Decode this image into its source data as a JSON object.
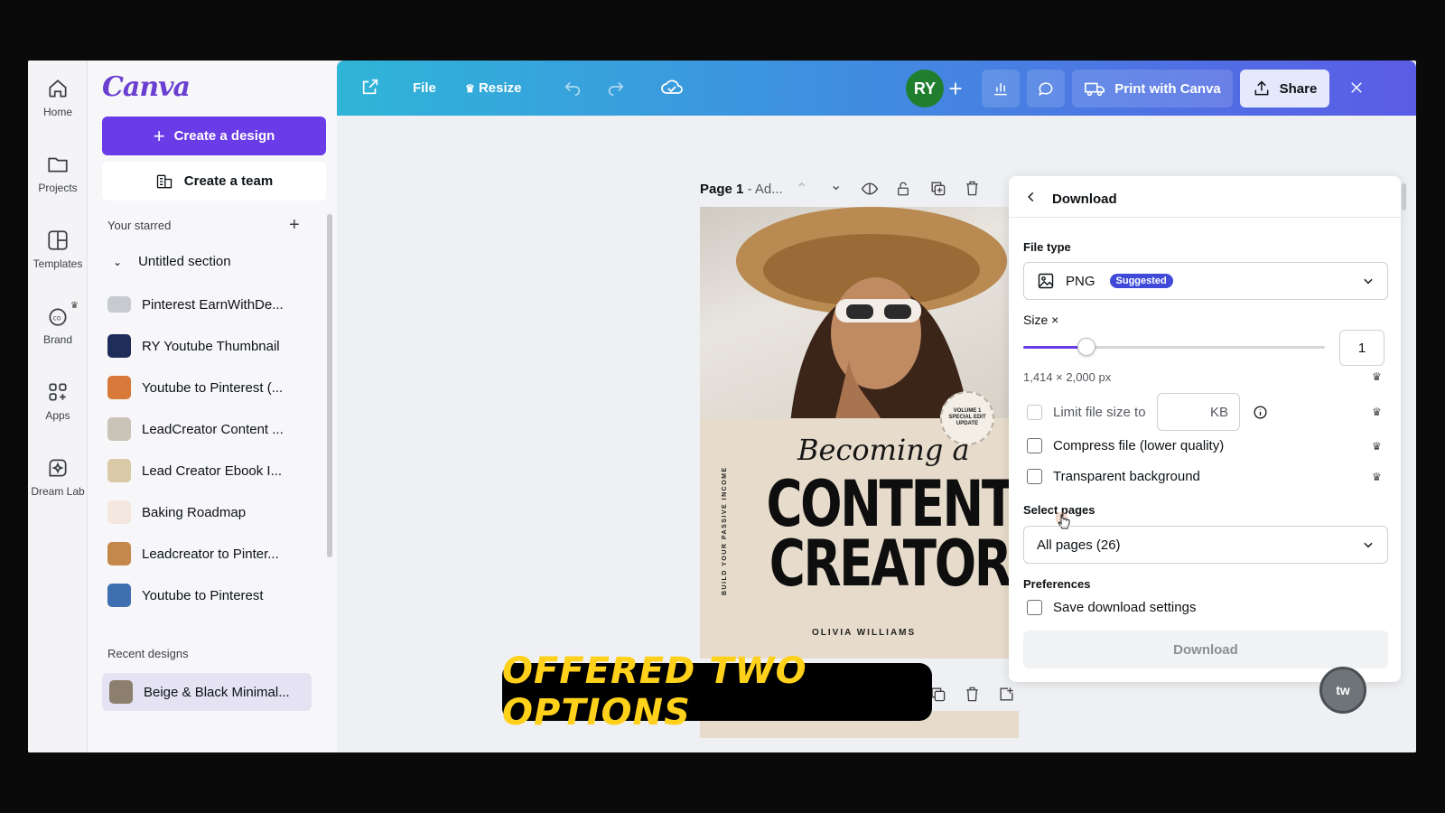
{
  "rail": {
    "items": [
      {
        "label": "Home",
        "icon": "home-icon"
      },
      {
        "label": "Projects",
        "icon": "folder-icon"
      },
      {
        "label": "Templates",
        "icon": "templates-icon"
      },
      {
        "label": "Brand",
        "icon": "brand-icon"
      },
      {
        "label": "Apps",
        "icon": "apps-icon"
      },
      {
        "label": "Dream Lab",
        "icon": "dream-lab-icon"
      }
    ]
  },
  "sidebar": {
    "logo": "Canva",
    "create_design": "Create a design",
    "create_team": "Create a team",
    "starred_label": "Your starred",
    "section_name": "Untitled section",
    "items": [
      {
        "label": "Pinterest EarnWithDe...",
        "color": "#b9bcc2"
      },
      {
        "label": "RY Youtube Thumbnail",
        "color": "#1e2d5a"
      },
      {
        "label": "Youtube to Pinterest (...",
        "color": "#d8793a"
      },
      {
        "label": "LeadCreator Content ...",
        "color": "#c9c3b8"
      },
      {
        "label": "Lead Creator Ebook I...",
        "color": "#d9c9a6"
      },
      {
        "label": "Baking Roadmap",
        "color": "#f3e7df"
      },
      {
        "label": "Leadcreator to Pinter...",
        "color": "#c4894a"
      },
      {
        "label": "Youtube to Pinterest",
        "color": "#3f6fb0"
      }
    ],
    "recent_label": "Recent designs",
    "recent_item": "Beige & Black Minimal..."
  },
  "topbar": {
    "file": "File",
    "resize": "Resize",
    "avatar": "RY",
    "print": "Print with Canva",
    "share": "Share"
  },
  "canvas": {
    "page_label_bold": "Page 1",
    "page_label_rest": " - Ad...",
    "poster": {
      "seal": "VOLUME 1 SPECIAL EDIT UPDATE",
      "script_line": "Becoming a",
      "title_1": "CONTENT",
      "title_2": "CREATOR",
      "side_text": "BUILD YOUR PASSIVE INCOME",
      "author": "OLIVIA WILLIAMS"
    }
  },
  "download_panel": {
    "title": "Download",
    "file_type_label": "File type",
    "file_type_value": "PNG",
    "suggested_badge": "Suggested",
    "size_label": "Size ×",
    "size_value": "1",
    "size_fraction": 0.21,
    "dimensions": "1,414 × 2,000 px",
    "limit_label": "Limit file size to",
    "kb_unit": "KB",
    "compress_label": "Compress file (lower quality)",
    "transparent_label": "Transparent background",
    "select_pages_label": "Select pages",
    "pages_value": "All pages (26)",
    "preferences_label": "Preferences",
    "save_settings_label": "Save download settings",
    "download_button": "Download"
  },
  "overlay": {
    "caption": "OFFERED TWO OPTIONS",
    "fab": "tw"
  },
  "colors": {
    "accent": "#6a3ce8",
    "badge": "#3f4bd8",
    "caption_text": "#ffd11a"
  }
}
